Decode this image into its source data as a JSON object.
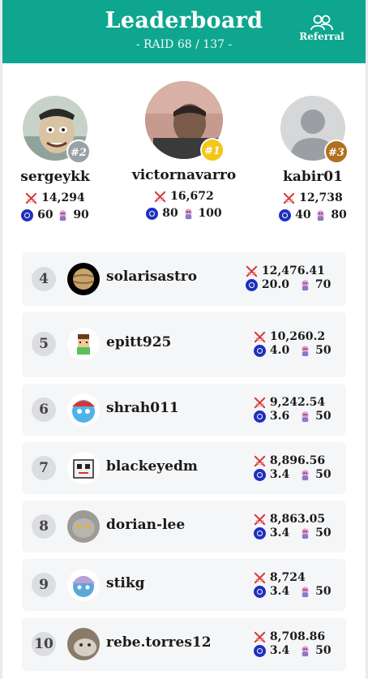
{
  "header": {
    "title": "Leaderboard",
    "subtitle": "- RAID 68 / 137 -",
    "referral_label": "Referral",
    "bg_color": "#0ea68e"
  },
  "icons": {
    "score": "crossed-swords-icon",
    "token": "coin-icon",
    "pet": "pet-icon"
  },
  "podium": [
    {
      "rank": "#2",
      "name": "sergeykk",
      "score": "14,294",
      "tokens": "60",
      "pets": "90",
      "badge_color": "#9aa0a6"
    },
    {
      "rank": "#1",
      "name": "victornavarro",
      "score": "16,672",
      "tokens": "80",
      "pets": "100",
      "badge_color": "#f5c518"
    },
    {
      "rank": "#3",
      "name": "kabir01",
      "score": "12,738",
      "tokens": "40",
      "pets": "80",
      "badge_color": "#b0701e"
    }
  ],
  "rows": [
    {
      "rank": "4",
      "name": "solarisastro",
      "score": "12,476.41",
      "tokens": "20.0",
      "pets": "70"
    },
    {
      "rank": "5",
      "name": "epitt925",
      "score": "10,260.2",
      "tokens": "4.0",
      "pets": "50"
    },
    {
      "rank": "6",
      "name": "shrah011",
      "score": "9,242.54",
      "tokens": "3.6",
      "pets": "50"
    },
    {
      "rank": "7",
      "name": "blackeyedm",
      "score": "8,896.56",
      "tokens": "3.4",
      "pets": "50"
    },
    {
      "rank": "8",
      "name": "dorian-lee",
      "score": "8,863.05",
      "tokens": "3.4",
      "pets": "50"
    },
    {
      "rank": "9",
      "name": "stikg",
      "score": "8,724",
      "tokens": "3.4",
      "pets": "50"
    },
    {
      "rank": "10",
      "name": "rebe.torres12",
      "score": "8,708.86",
      "tokens": "3.4",
      "pets": "50"
    }
  ]
}
